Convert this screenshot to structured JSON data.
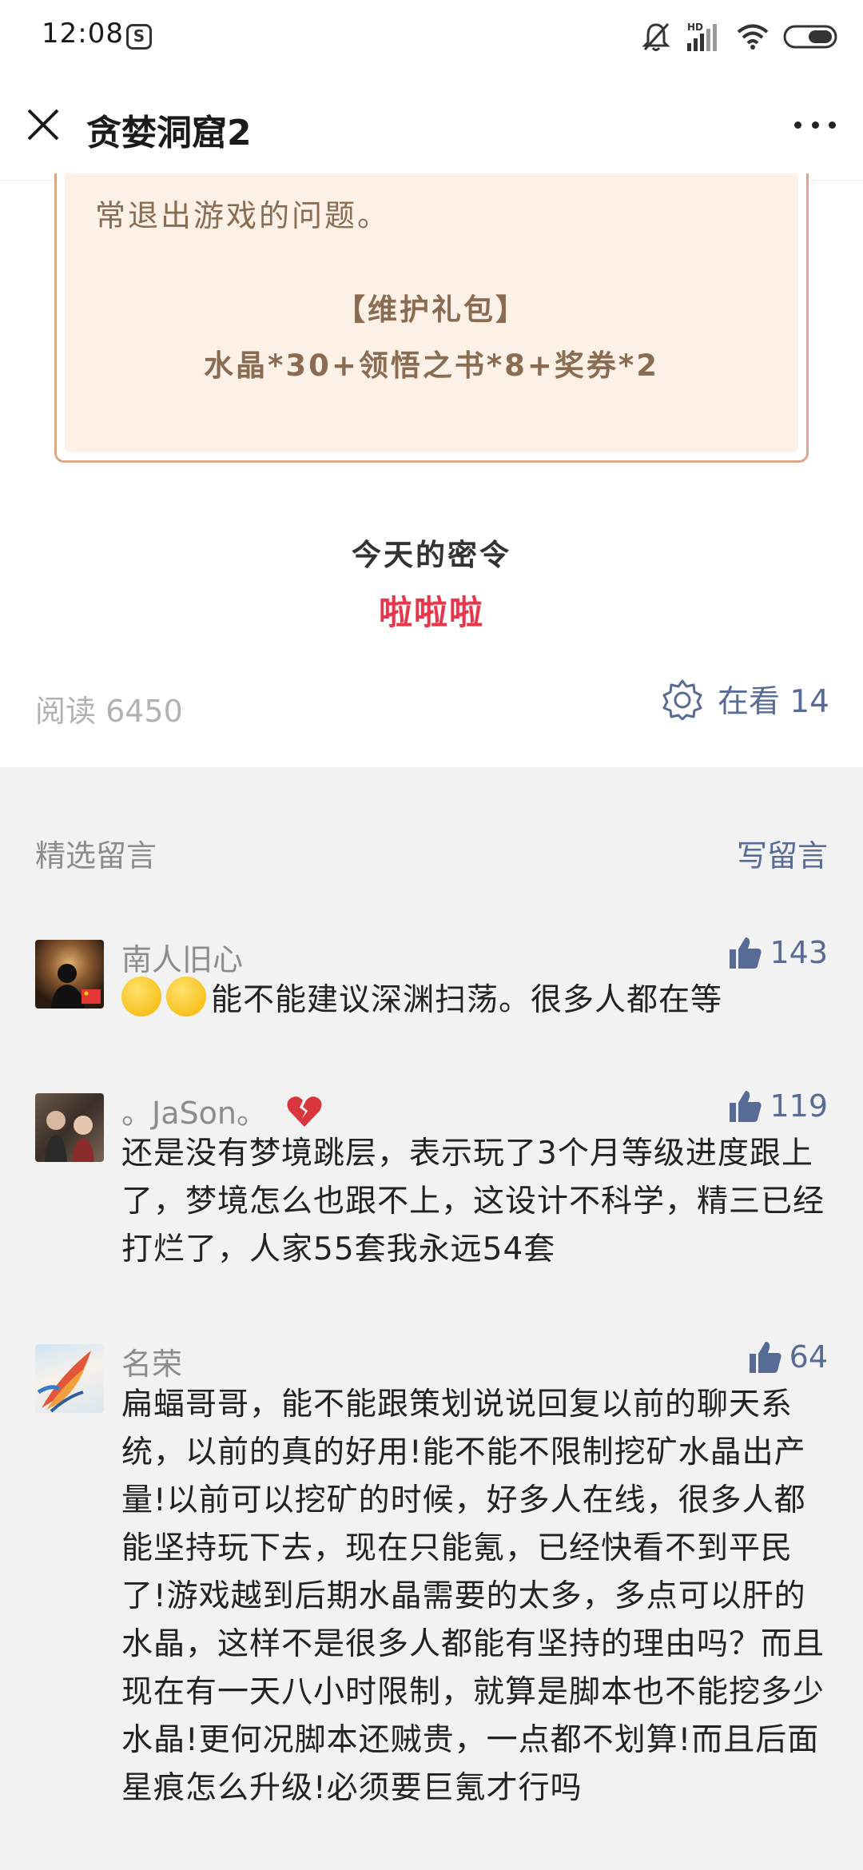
{
  "status_bar": {
    "time": "12:08",
    "app_icon": "S",
    "hd_label": "HD",
    "icons": [
      "mute-bell-icon",
      "signal-icon",
      "wifi-icon",
      "battery-icon"
    ]
  },
  "title_bar": {
    "title": "贪婪洞窟2"
  },
  "article": {
    "notice_text": "常退出游戏的问题。",
    "gift_title": "【维护礼包】",
    "gift_content": "水晶*30+领悟之书*8+奖券*2",
    "password_label": "今天的密令",
    "password_value": "啦啦啦",
    "read_count": "阅读 6450",
    "watching_label": "在看 14"
  },
  "comments": {
    "header_title": "精选留言",
    "write_label": "写留言",
    "items": [
      {
        "nickname": "南人旧心",
        "likes": "143",
        "text": "能不能建议深渊扫荡。很多人都在等"
      },
      {
        "nickname": "。JaSon。",
        "likes": "119",
        "text": "还是没有梦境跳层，表示玩了3个月等级进度跟上了，梦境怎么也跟不上，这设计不科学，精三已经打烂了，人家55套我永远54套"
      },
      {
        "nickname": "名荣",
        "likes": "64",
        "text": "扁蝠哥哥，能不能跟策划说说回复以前的聊天系统，以前的真的好用!能不能不限制挖矿水晶出产量!以前可以挖矿的时候，好多人在线，很多人都能坚持玩下去，现在只能氪，已经快看不到平民了!游戏越到后期水晶需要的太多，多点可以肝的水晶，这样不是很多人都能有坚持的理由吗？而且现在有一天八小时限制，就算是脚本也不能挖多少水晶!更何况脚本还贼贵，一点都不划算!而且后面星痕怎么升级!必须要巨氪才行吗"
      }
    ]
  },
  "colors": {
    "link": "#576b95",
    "password": "#e8364c",
    "notice_text": "#8a6c52",
    "notice_bg": "#fdf0e6",
    "notice_border": "#dca687"
  }
}
